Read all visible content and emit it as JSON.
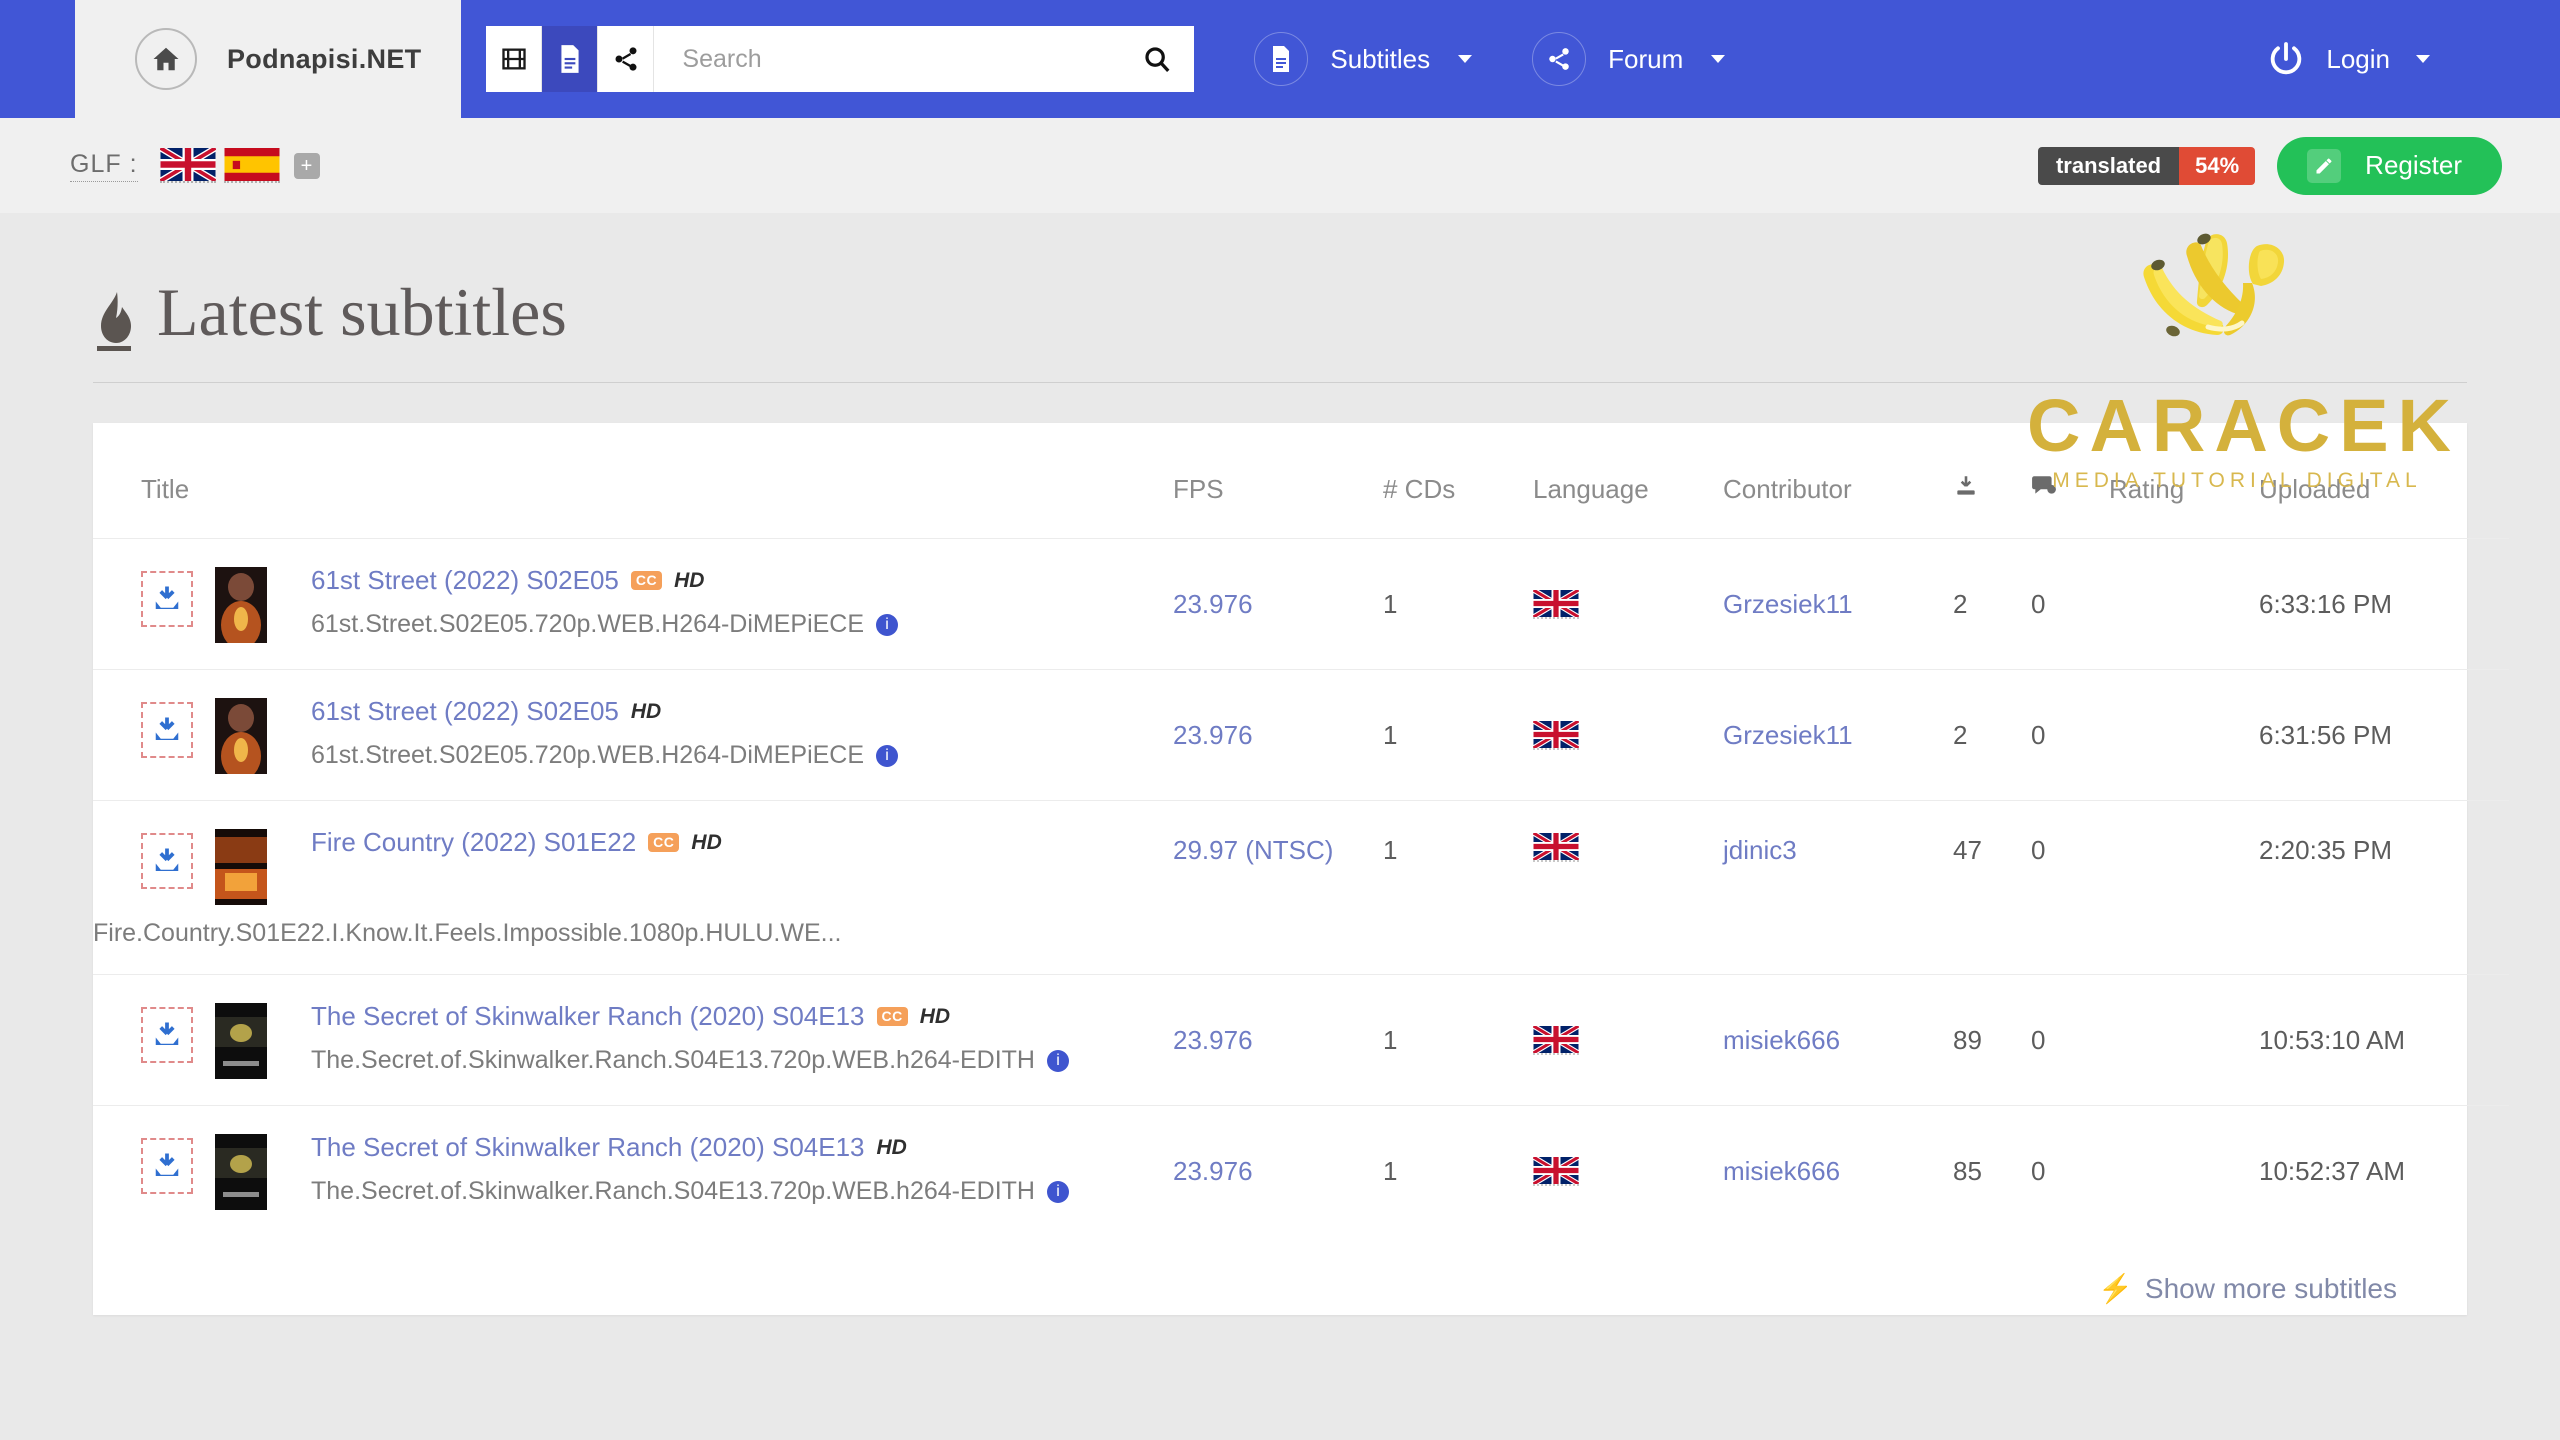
{
  "header": {
    "brand": "Podnapisi.NET",
    "home_icon": "home-icon",
    "toggles": [
      {
        "name": "film-icon",
        "active": false
      },
      {
        "name": "document-icon",
        "active": true
      },
      {
        "name": "share-icon",
        "active": false
      }
    ],
    "search": {
      "value": "",
      "placeholder": "Search",
      "button_icon": "search-icon"
    },
    "nav": [
      {
        "label": "Subtitles",
        "icon": "document-icon",
        "has_caret": true
      },
      {
        "label": "Forum",
        "icon": "share-icon",
        "has_caret": true
      }
    ],
    "account": {
      "label": "Login",
      "icon": "power-icon",
      "has_caret": true
    }
  },
  "subbar": {
    "glf_label": "GLF :",
    "flags": [
      "united-kingdom-flag",
      "spain-flag"
    ],
    "add_language": "+",
    "translated": {
      "label": "translated",
      "value": "54%"
    },
    "register": {
      "label": "Register",
      "icon": "pencil-icon"
    }
  },
  "watermark": {
    "title": "CARACEK",
    "subtitle": "MEDIA TUTORIAL DIGITAL",
    "logo": "bananas-icon"
  },
  "page": {
    "title": "Latest subtitles",
    "title_icon": "flame-icon",
    "show_more": "Show more subtitles",
    "show_more_icon": "bolt-icon"
  },
  "table": {
    "headers": {
      "title": "Title",
      "fps": "FPS",
      "cds": "# CDs",
      "language": "Language",
      "contributor": "Contributor",
      "downloads_icon": "download-icon",
      "comments_icon": "comment-icon",
      "rating": "Rating",
      "uploaded": "Uploaded"
    },
    "rows": [
      {
        "title": "61st Street (2022) S02E05",
        "cc": "CC",
        "hd": "HD",
        "release": "61st.Street.S02E05.720p.WEB.H264-DiMEPiECE",
        "release_wide": false,
        "fps": "23.976",
        "cds": "1",
        "language": "united-kingdom-flag",
        "contributor": "Grzesiek11",
        "downloads": "2",
        "comments": "0",
        "rating": "",
        "uploaded": "6:33:16 PM"
      },
      {
        "title": "61st Street (2022) S02E05",
        "cc": "",
        "hd": "HD",
        "release": "61st.Street.S02E05.720p.WEB.H264-DiMEPiECE",
        "release_wide": false,
        "fps": "23.976",
        "cds": "1",
        "language": "united-kingdom-flag",
        "contributor": "Grzesiek11",
        "downloads": "2",
        "comments": "0",
        "rating": "",
        "uploaded": "6:31:56 PM"
      },
      {
        "title": "Fire Country (2022) S01E22",
        "cc": "CC",
        "hd": "HD",
        "release": "Fire.Country.S01E22.I.Know.It.Feels.Impossible.1080p.HULU.WE...",
        "release_wide": true,
        "fps": "29.97 (NTSC)",
        "cds": "1",
        "language": "united-kingdom-flag",
        "contributor": "jdinic3",
        "downloads": "47",
        "comments": "0",
        "rating": "",
        "uploaded": "2:20:35 PM"
      },
      {
        "title": "The Secret of Skinwalker Ranch (2020) S04E13",
        "cc": "CC",
        "hd": "HD",
        "release": "The.Secret.of.Skinwalker.Ranch.S04E13.720p.WEB.h264-EDITH",
        "release_wide": false,
        "fps": "23.976",
        "cds": "1",
        "language": "united-kingdom-flag",
        "contributor": "misiek666",
        "downloads": "89",
        "comments": "0",
        "rating": "",
        "uploaded": "10:53:10 AM"
      },
      {
        "title": "The Secret of Skinwalker Ranch (2020) S04E13",
        "cc": "",
        "hd": "HD",
        "release": "The.Secret.of.Skinwalker.Ranch.S04E13.720p.WEB.h264-EDITH",
        "release_wide": false,
        "fps": "23.976",
        "cds": "1",
        "language": "united-kingdom-flag",
        "contributor": "misiek666",
        "downloads": "85",
        "comments": "0",
        "rating": "",
        "uploaded": "10:52:37 AM"
      }
    ]
  },
  "colors": {
    "nav_blue": "#4156d6",
    "accent_green": "#23c158",
    "link_blue": "#6f7cc4",
    "badge_red": "#e04b35",
    "cc_orange": "#f5a05a"
  }
}
